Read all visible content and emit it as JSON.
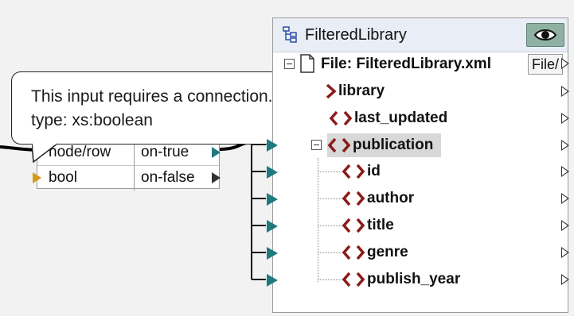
{
  "tooltip": {
    "line1": "This input requires a connection.",
    "line2": "type: xs:boolean"
  },
  "filter": {
    "rows": [
      {
        "left": "node/row",
        "right": "on-true"
      },
      {
        "left": "bool",
        "right": "on-false"
      }
    ]
  },
  "component": {
    "title": "FilteredLibrary",
    "file_label": "File: FilteredLibrary.xml",
    "file_button": "File/",
    "nodes": {
      "library": "library",
      "last_updated": "last_updated",
      "publication": "publication",
      "id": "id",
      "author": "author",
      "title": "title",
      "genre": "genre",
      "publish_year": "publish_year"
    }
  },
  "colors": {
    "accent_teal": "#1f7a80",
    "element_red": "#8b1a1a",
    "tooltip_border": "#222222",
    "eye_button": "#8fb1a4"
  }
}
